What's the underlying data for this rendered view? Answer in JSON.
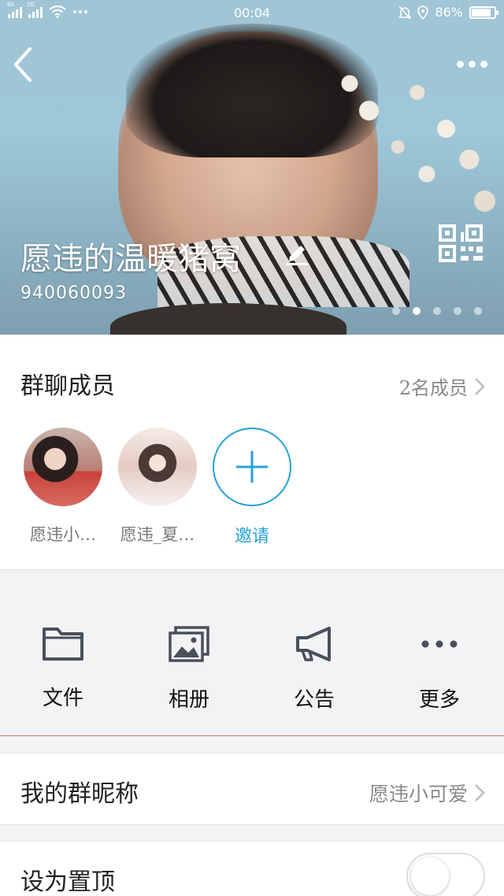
{
  "status_bar": {
    "signal1_tag": "4G",
    "signal2_tag": "2G",
    "time": "00:04",
    "battery": "86%",
    "battery_level": 0.86
  },
  "header": {
    "group_name": "愿违的温暖猪窝",
    "group_id": "940060093",
    "banner_pages": 5,
    "active_page": 2
  },
  "members_section": {
    "title": "群聊成员",
    "count_label": "2名成员",
    "members": [
      {
        "name": "愿违小…"
      },
      {
        "name": "愿违_夏…"
      }
    ],
    "invite_label": "邀请"
  },
  "functions": [
    {
      "label": "文件",
      "icon": "folder-icon"
    },
    {
      "label": "相册",
      "icon": "album-icon"
    },
    {
      "label": "公告",
      "icon": "megaphone-icon"
    },
    {
      "label": "更多",
      "icon": "more-dots-icon"
    }
  ],
  "settings": {
    "nickname_label": "我的群昵称",
    "nickname_value": "愿违小可爱",
    "pin_label": "设为置顶",
    "pin_enabled": false
  },
  "colors": {
    "accent": "#26a0d8",
    "divider_accent": "#d07a6a"
  }
}
